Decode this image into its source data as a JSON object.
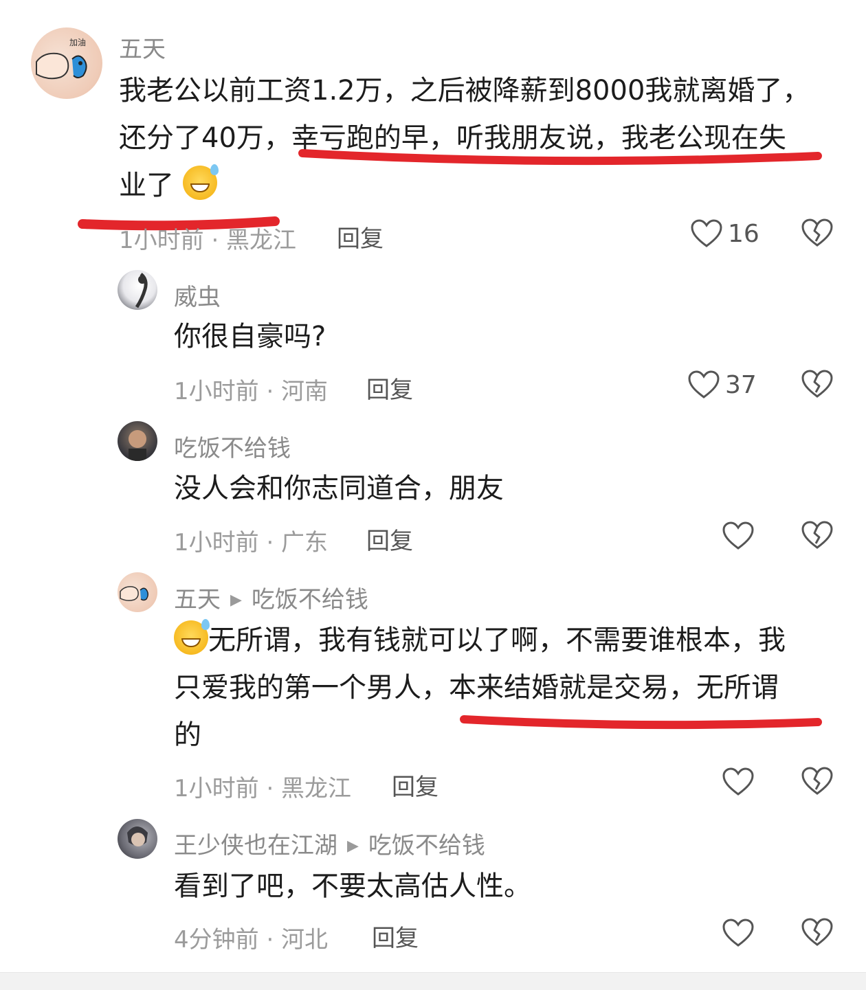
{
  "comments": [
    {
      "author": "五天",
      "text_lines": [
        "我老公以前工资1.2万，之后被降薪到8000我就离婚了，",
        "还分了40万，幸亏跑的早，听我朋友说，我老公现在失",
        "业了"
      ],
      "emoji": "grinning-sweat-emoji",
      "meta": "1小时前 · 黑龙江",
      "reply_label": "回复",
      "likes": "16"
    },
    {
      "author": "威虫",
      "text": "你很自豪吗?",
      "meta": "1小时前 · 河南",
      "reply_label": "回复",
      "likes": "37"
    },
    {
      "author": "吃饭不给钱",
      "text": "没人会和你志同道合，朋友",
      "meta": "1小时前 · 广东",
      "reply_label": "回复",
      "likes": ""
    },
    {
      "author": "五天",
      "reply_to": "吃饭不给钱",
      "text_lines": [
        "无所谓，我有钱就可以了啊，不需要谁根本，我",
        "只爱我的第一个男人，本来结婚就是交易，无所谓",
        "的"
      ],
      "meta": "1小时前 · 黑龙江",
      "reply_label": "回复",
      "likes": ""
    },
    {
      "author": "王少侠也在江湖",
      "reply_to": "吃饭不给钱",
      "text": "看到了吧，不要太高估人性。",
      "meta": "4分钟前 · 河北",
      "reply_label": "回复",
      "likes": ""
    }
  ],
  "colors": {
    "underline": "#e3262b",
    "meta": "#9b9b9b",
    "name": "#8a8a8a"
  }
}
